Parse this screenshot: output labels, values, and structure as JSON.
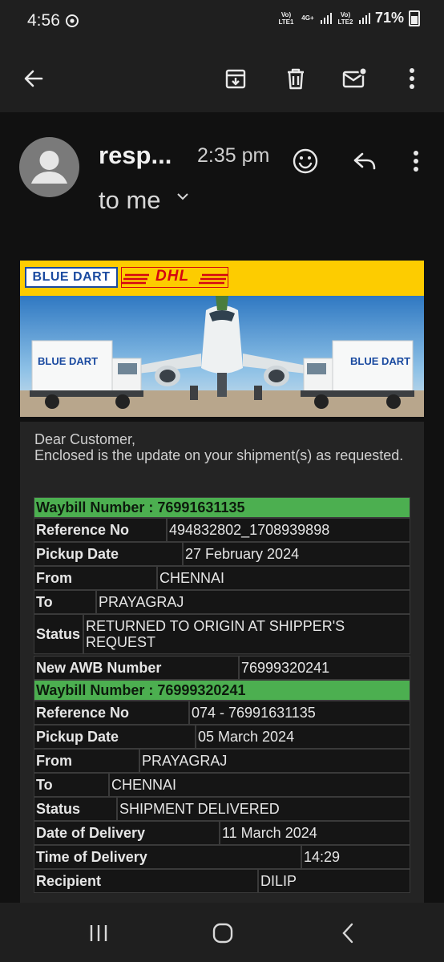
{
  "status_bar": {
    "time": "4:56",
    "sim1": "Vo) LTE1",
    "sim2": "Vo) LTE2",
    "net": "4G+",
    "battery": "71%"
  },
  "toolbar": {
    "back_icon": "arrow-left-icon",
    "archive_icon": "archive-icon",
    "delete_icon": "trash-icon",
    "mark_unread_icon": "mail-unread-icon",
    "more_icon": "more-vertical-icon"
  },
  "message": {
    "sender": "resp...",
    "time": "2:35 pm",
    "recipient_line": "to me"
  },
  "banner": {
    "bluedart_logo": "BLUE DART",
    "dhl_logo": "DHL",
    "truck_label": "BLUE DART"
  },
  "body": {
    "greeting": "Dear Customer,",
    "intro": "Enclosed is the update on your shipment(s) as requested."
  },
  "shipments": [
    {
      "waybill_label": "Waybill Number : 76991631135",
      "rows": [
        {
          "label": "Reference No",
          "value": "494832802_1708939898"
        },
        {
          "label": "Pickup Date",
          "value": "27 February 2024"
        },
        {
          "label": "From",
          "value": "CHENNAI"
        },
        {
          "label": "To",
          "value": "PRAYAGRAJ"
        },
        {
          "label": "Status",
          "value": "RETURNED TO ORIGIN AT SHIPPER'S REQUEST"
        },
        {
          "label": "New AWB Number",
          "value": "76999320241"
        }
      ]
    },
    {
      "waybill_label": "Waybill Number : 76999320241",
      "rows": [
        {
          "label": "Reference No",
          "value": "074 - 76991631135"
        },
        {
          "label": "Pickup Date",
          "value": "05 March 2024"
        },
        {
          "label": "From",
          "value": "PRAYAGRAJ"
        },
        {
          "label": "To",
          "value": "CHENNAI"
        },
        {
          "label": "Status",
          "value": "SHIPMENT DELIVERED"
        },
        {
          "label": "Date of Delivery",
          "value": "11 March 2024"
        },
        {
          "label": "Time of Delivery",
          "value": "14:29"
        },
        {
          "label": "Recipient",
          "value": "DILIP"
        }
      ]
    }
  ],
  "colors": {
    "waybill_bar": "#4caf50",
    "banner_yellow": "#fdcc00",
    "dhl_red": "#d40511",
    "bluedart_blue": "#1a4aa0"
  }
}
